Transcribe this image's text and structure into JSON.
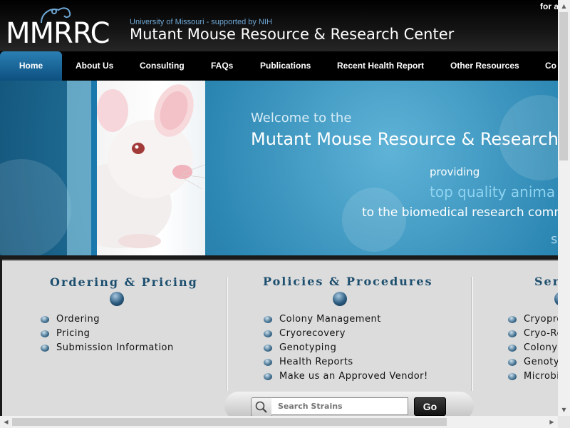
{
  "header": {
    "logo": "MMRRC",
    "university": "University of Missouri - supported by NIH",
    "center_name": "Mutant Mouse Resource & Research Center",
    "top_right_text": "for a"
  },
  "nav": {
    "items": [
      {
        "label": "Home",
        "active": true
      },
      {
        "label": "About Us"
      },
      {
        "label": "Consulting"
      },
      {
        "label": "FAQs"
      },
      {
        "label": "Publications"
      },
      {
        "label": "Recent Health Report"
      },
      {
        "label": "Other Resources"
      },
      {
        "label": "Co"
      }
    ]
  },
  "banner": {
    "welcome": "Welcome to the",
    "title": "Mutant Mouse Resource & Research",
    "providing": "providing",
    "highlight": "top quality anima",
    "tagline": "to the biomedical research comm",
    "partial": "s"
  },
  "sections": [
    {
      "title": "Ordering & Pricing",
      "items": [
        "Ordering",
        "Pricing",
        "Submission Information"
      ]
    },
    {
      "title": "Policies & Procedures",
      "items": [
        "Colony Management",
        "Cryorecovery",
        "Genotyping",
        "Health Reports",
        "Make us an Approved Vendor!"
      ]
    },
    {
      "title": "Serv",
      "items": [
        "Cryopre",
        "Cryo-Re",
        "Colony",
        "Genoty",
        "Microbi"
      ]
    }
  ],
  "search": {
    "placeholder": "Search Strains",
    "go_label": "Go"
  },
  "colors": {
    "nav_active": "#1f6fa3",
    "section_title": "#1c4e6e",
    "banner_blue": "#2c87b3"
  }
}
